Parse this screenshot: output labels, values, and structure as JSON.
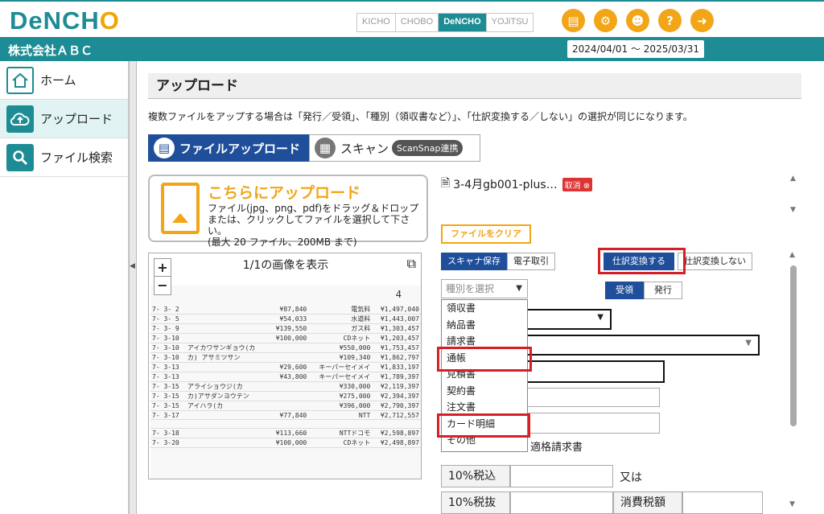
{
  "header": {
    "logo": "DeNCHO",
    "products": [
      "KICHO",
      "CHOBO",
      "DeNCHO",
      "YOJiTSU"
    ],
    "active_product": "DeNCHO",
    "icons": [
      "document-icon",
      "gear-icon",
      "user-settings-icon",
      "help-icon",
      "logout-icon"
    ]
  },
  "band": {
    "company": "株式会社ＡＢＣ",
    "period": "2024/04/01 ～ 2025/03/31"
  },
  "sidebar": {
    "items": [
      {
        "label": "ホーム",
        "icon": "home-icon"
      },
      {
        "label": "アップロード",
        "icon": "cloud-upload-icon",
        "active": true
      },
      {
        "label": "ファイル検索",
        "icon": "search-icon"
      }
    ]
  },
  "main": {
    "title": "アップロード",
    "notice": "複数ファイルをアップする場合は「発行／受領」、「種別（領収書など）」、「仕訳変換する／しない」の選択が同じになります。",
    "tabs": {
      "upload": "ファイルアップロード",
      "scan": "スキャン",
      "scansnap": "ScanSnap連携"
    },
    "dropzone": {
      "title": "こちらにアップロード",
      "line1": "ファイル(jpg、png、pdf)をドラッグ＆ドロップ",
      "line2": "または、クリックしてファイルを選択して下さい。",
      "line3": "(最大 20 ファイル、200MB まで)"
    },
    "viewer": {
      "title": "1/1の画像を表示",
      "zoom_in": "+",
      "zoom_out": "−",
      "page_mark": "4"
    },
    "file": {
      "name": "3-4月gb001-plus…",
      "cancel": "取消"
    },
    "clear_button": "ファイルをクリア",
    "source": {
      "scanner": "スキャナ保存",
      "ecommerce": "電子取引"
    },
    "journal": {
      "convert": "仕訳変換する",
      "no_convert": "仕訳変換しない"
    },
    "direction": {
      "received": "受領",
      "issued": "発行"
    },
    "type_select": {
      "placeholder": "種別を選択",
      "options": [
        "領収書",
        "納品書",
        "請求書",
        "通帳",
        "見積書",
        "契約書",
        "注文書",
        "カード明細",
        "その他"
      ]
    },
    "qualified_invoice": "適格請求書",
    "tax": {
      "incl10": "10%税込",
      "or": "又は",
      "excl10": "10%税抜",
      "tax_amount": "消費税額"
    }
  },
  "scan_rows": [
    [
      "7- 3- 2",
      "",
      "¥87,840",
      "電気料",
      "¥1,497,040"
    ],
    [
      "7- 3- 5",
      "",
      "¥54,033",
      "水道料",
      "¥1,443,007"
    ],
    [
      "7- 3- 9",
      "",
      "¥139,550",
      "ガス料",
      "¥1,303,457"
    ],
    [
      "7- 3-10",
      "",
      "¥100,000",
      "CDネット",
      "¥1,203,457"
    ],
    [
      "7- 3-10",
      "アイカワサンギョウ(カ",
      "",
      "¥550,000",
      "¥1,753,457"
    ],
    [
      "7- 3-10",
      "カ) アサミツサン",
      "",
      "¥109,340",
      "¥1,862,797"
    ],
    [
      "7- 3-13",
      "",
      "¥29,600",
      "キーパーセイメイ",
      "¥1,833,197"
    ],
    [
      "7- 3-13",
      "",
      "¥43,800",
      "キーパーセイメイ",
      "¥1,789,397"
    ],
    [
      "7- 3-15",
      "アライショウジ(カ",
      "",
      "¥330,000",
      "¥2,119,397"
    ],
    [
      "7- 3-15",
      "カ)アサダンヨウテン",
      "",
      "¥275,000",
      "¥2,394,397"
    ],
    [
      "7- 3-15",
      "アイハラ(カ",
      "",
      "¥396,000",
      "¥2,790,397"
    ],
    [
      "7- 3-17",
      "",
      "¥77,840",
      "NTT",
      "¥2,712,557"
    ],
    [
      "",
      "",
      "",
      "",
      ""
    ],
    [
      "7- 3-18",
      "",
      "¥113,660",
      "NTTドコモ",
      "¥2,598,897"
    ],
    [
      "7- 3-20",
      "",
      "¥100,000",
      "CDネット",
      "¥2,498,897"
    ]
  ]
}
